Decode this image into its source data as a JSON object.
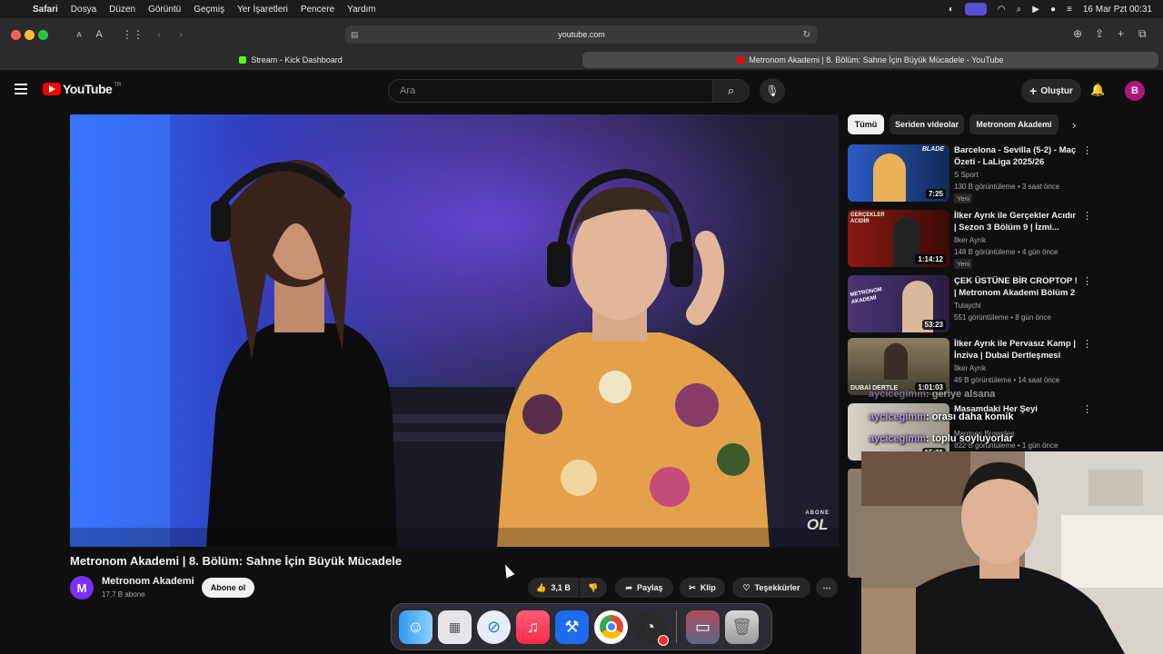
{
  "menubar": {
    "app": "Safari",
    "items": [
      "Dosya",
      "Düzen",
      "Görüntü",
      "Geçmiş",
      "Yer İşaretleri",
      "Pencere",
      "Yardım"
    ],
    "datetime": "16 Mar Pzt  00:31"
  },
  "browser": {
    "url": "youtube.com",
    "font_small": "A",
    "font_large": "A",
    "tabs": [
      {
        "title": "Stream - Kick Dashboard",
        "favicon_color": "#53fc18"
      },
      {
        "title": "Metronom Akademi | 8. Bölüm: Sahne İçin Büyük Mücadele - YouTube",
        "favicon_color": "#ff0000"
      }
    ]
  },
  "youtube": {
    "logo_text": "YouTube",
    "country_code": "TR",
    "search_placeholder": "Ara",
    "create_label": "Oluştur",
    "avatar_letter": "B",
    "video": {
      "title": "Metronom Akademi | 8. Bölüm: Sahne İçin Büyük Mücadele",
      "watermark_top": "ABONE",
      "watermark_bottom": "OL",
      "channel": "Metronom Akademi",
      "channel_initial": "M",
      "subscribers": "17,7 B abone",
      "subscribe_label": "Abone ol",
      "likes": "3,1 B",
      "share_label": "Paylaş",
      "clip_label": "Klip",
      "thanks_label": "Teşekkürler"
    },
    "chips": [
      "Tümü",
      "Seriden videolar",
      "Metronom Akademi"
    ],
    "recommendations": [
      {
        "title": "Barcelona - Sevilla (5-2) - Maç Özeti - LaLiga 2025/26",
        "channel": "S Sport",
        "meta": "130 B görüntüleme • 3 saat önce",
        "badge": "Yeni",
        "duration": "7:25",
        "thumb": "#1d3b77",
        "thumb_text": "BLADE"
      },
      {
        "title": "İlker Ayrık ile Gerçekler Acıdır | Sezon 3 Bölüm 9 | İzmi...",
        "channel": "İlker Ayrık",
        "meta": "148 B görüntüleme • 4 gün önce",
        "badge": "Yeni",
        "duration": "1:14:12",
        "thumb": "#6b1410",
        "thumb_text": "GERÇEKLER ACIDIR"
      },
      {
        "title": "ÇEK ÜSTÜNE BİR CROPTOP ! | Metronom Akademi Bölüm 2",
        "channel": "Tulaychi",
        "meta": "551 görüntüleme • 8 gün önce",
        "badge": "",
        "duration": "53:23",
        "thumb": "#3a2b57",
        "thumb_text": "METRONOM AKADEMİ"
      },
      {
        "title": "İlker Ayrık ile Pervasız Kamp | İnziva | Dubai Dertleşmesi",
        "channel": "İlker Ayrık",
        "meta": "49 B görüntüleme • 14 saat önce",
        "badge": "",
        "duration": "1:01:03",
        "thumb": "#5a5040",
        "thumb_text": "DUBAİ DERTLE"
      },
      {
        "title": "Masamdaki Her Şeyi",
        "channel": "Marques Brownlee",
        "meta": "822 B görüntüleme • 1 gün önce",
        "badge": "",
        "duration": "15:31",
        "thumb": "#b9b3a8",
        "thumb_text": ""
      }
    ]
  },
  "chat_overlay": [
    {
      "user": "aycicegimm",
      "text": ": geriye alsana"
    },
    {
      "user": "aycicegimm",
      "text": ": orası daha komik"
    },
    {
      "user": "aycicegimm",
      "text": ": toplu soyluyorlar"
    }
  ],
  "dock": [
    "finder-icon",
    "launchpad-icon",
    "safari-icon",
    "music-icon",
    "xcode-icon",
    "chrome-icon",
    "obs-icon",
    "folder-icon",
    "trash-icon"
  ]
}
